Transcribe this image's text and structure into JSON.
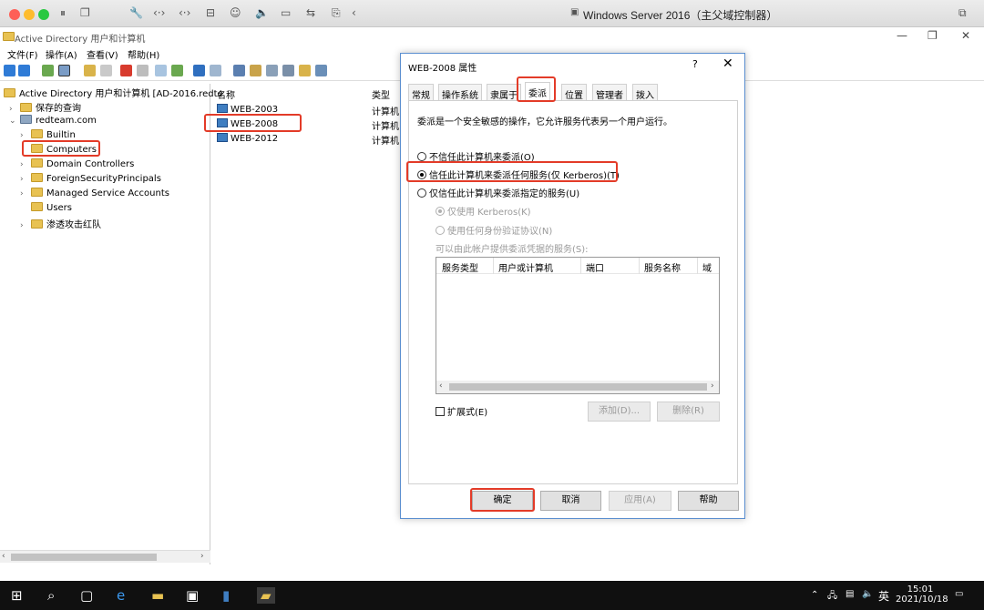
{
  "host": {
    "title": "Windows Server 2016（主父域控制器）",
    "toolbar_icons": [
      "pause-icon",
      "snapshot-icon",
      "wrench-icon",
      "network-icon",
      "arrows-icon",
      "drive-icon",
      "user-icon",
      "sound-icon",
      "camera-icon",
      "usb-icon",
      "share-icon",
      "back-icon"
    ]
  },
  "window": {
    "title": "Active Directory 用户和计算机"
  },
  "menu": [
    "文件(F)",
    "操作(A)",
    "查看(V)",
    "帮助(H)"
  ],
  "tree": {
    "root": "Active Directory 用户和计算机 [AD-2016.redte",
    "saved_queries": "保存的查询",
    "domain": "redteam.com",
    "items": [
      {
        "label": "Builtin",
        "expandable": true
      },
      {
        "label": "Computers",
        "expandable": false
      },
      {
        "label": "Domain Controllers",
        "expandable": true
      },
      {
        "label": "ForeignSecurityPrincipals",
        "expandable": true
      },
      {
        "label": "Managed Service Accounts",
        "expandable": true
      },
      {
        "label": "Users",
        "expandable": false
      },
      {
        "label": "渗透攻击红队",
        "expandable": true
      }
    ]
  },
  "list": {
    "columns": [
      "名称",
      "类型"
    ],
    "rows": [
      {
        "name": "WEB-2003",
        "type": "计算机"
      },
      {
        "name": "WEB-2008",
        "type": "计算机"
      },
      {
        "name": "WEB-2012",
        "type": "计算机"
      }
    ]
  },
  "dialog": {
    "title": "WEB-2008 属性",
    "help": "?",
    "close": "✕",
    "tabs": [
      "常规",
      "操作系统",
      "隶属于",
      "委派",
      "位置",
      "管理者",
      "拨入"
    ],
    "active_tab": "委派",
    "description": "委派是一个安全敏感的操作，它允许服务代表另一个用户运行。",
    "options": {
      "none": "不信任此计算机来委派(O)",
      "any": "信任此计算机来委派任何服务(仅 Kerberos)(T)",
      "specific": "仅信任此计算机来委派指定的服务(U)",
      "kerberos_only": "仅使用 Kerberos(K)",
      "any_protocol": "使用任何身份验证协议(N)"
    },
    "services_label": "可以由此帐户提供委派凭据的服务(S):",
    "service_columns": [
      "服务类型",
      "用户或计算机",
      "端口",
      "服务名称",
      "域"
    ],
    "expanded": "扩展式(E)",
    "add": "添加(D)...",
    "remove": "删除(R)",
    "ok": "确定",
    "cancel": "取消",
    "apply": "应用(A)",
    "helpbtn": "帮助"
  },
  "taskbar": {
    "time": "15:01",
    "date": "2021/10/18",
    "lang": "英"
  },
  "colors": {
    "highlight": "#e33b28",
    "taskbar": "#101010"
  }
}
